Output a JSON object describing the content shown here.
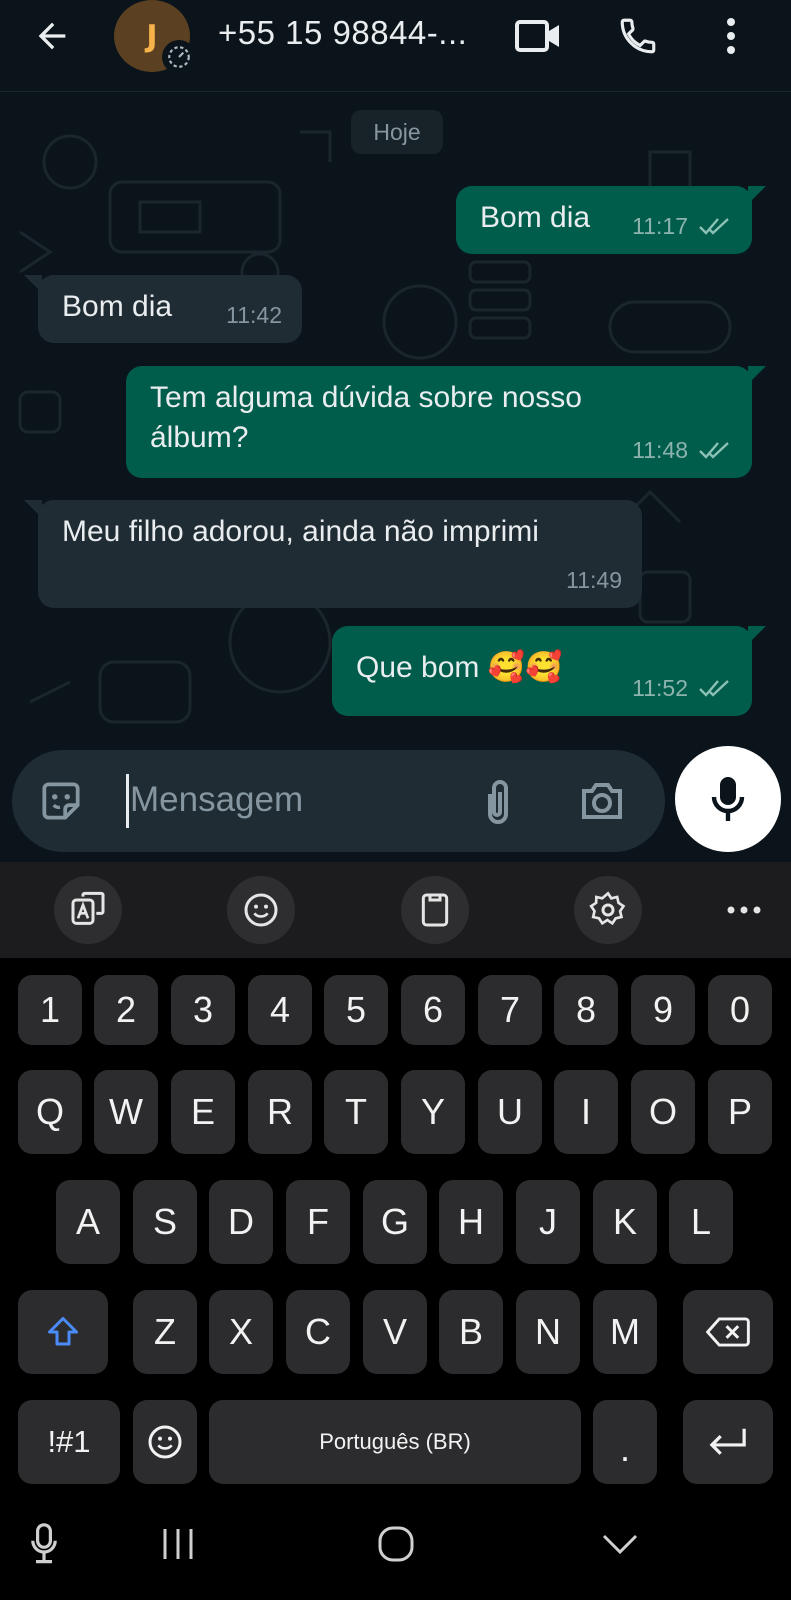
{
  "header": {
    "contact_name": "+55 15 98844-...",
    "avatar_letter": "J",
    "icons": [
      "back-arrow-icon",
      "timer-icon",
      "video-call-icon",
      "phone-icon",
      "more-vert-icon"
    ]
  },
  "chat": {
    "date_label": "Hoje",
    "messages": [
      {
        "direction": "out",
        "text": "Bom dia",
        "time": "11:17",
        "status": "read"
      },
      {
        "direction": "in",
        "text": "Bom dia",
        "time": "11:42"
      },
      {
        "direction": "out",
        "text_line1": "Tem alguma dúvida sobre nosso",
        "text_line2": "álbum?",
        "time": "11:48",
        "status": "read"
      },
      {
        "direction": "in",
        "text": "Meu filho adorou, ainda não imprimi",
        "time": "11:49"
      },
      {
        "direction": "out",
        "text": "Que bom 🥰🥰",
        "time": "11:52",
        "status": "read"
      }
    ]
  },
  "composer": {
    "placeholder": "Mensagem",
    "icons": [
      "sticker-icon",
      "attach-icon",
      "camera-icon",
      "mic-icon"
    ]
  },
  "keyboard": {
    "toolbar_icons": [
      "translate-icon",
      "emoji-icon",
      "clipboard-icon",
      "settings-icon",
      "more-horiz-icon"
    ],
    "row_numbers": [
      "1",
      "2",
      "3",
      "4",
      "5",
      "6",
      "7",
      "8",
      "9",
      "0"
    ],
    "row1": [
      "Q",
      "W",
      "E",
      "R",
      "T",
      "Y",
      "U",
      "I",
      "O",
      "P"
    ],
    "row2": [
      "A",
      "S",
      "D",
      "F",
      "G",
      "H",
      "J",
      "K",
      "L"
    ],
    "row3": [
      "Z",
      "X",
      "C",
      "V",
      "B",
      "N",
      "M"
    ],
    "symbols_key": "!#1",
    "space_label": "Português (BR)",
    "period_key": "."
  },
  "colors": {
    "background": "#0b141a",
    "outgoing_bubble": "#005c4b",
    "incoming_bubble": "#202c33",
    "read_tick": "#8cc1b5",
    "shift_accent": "#4a8cf7"
  }
}
